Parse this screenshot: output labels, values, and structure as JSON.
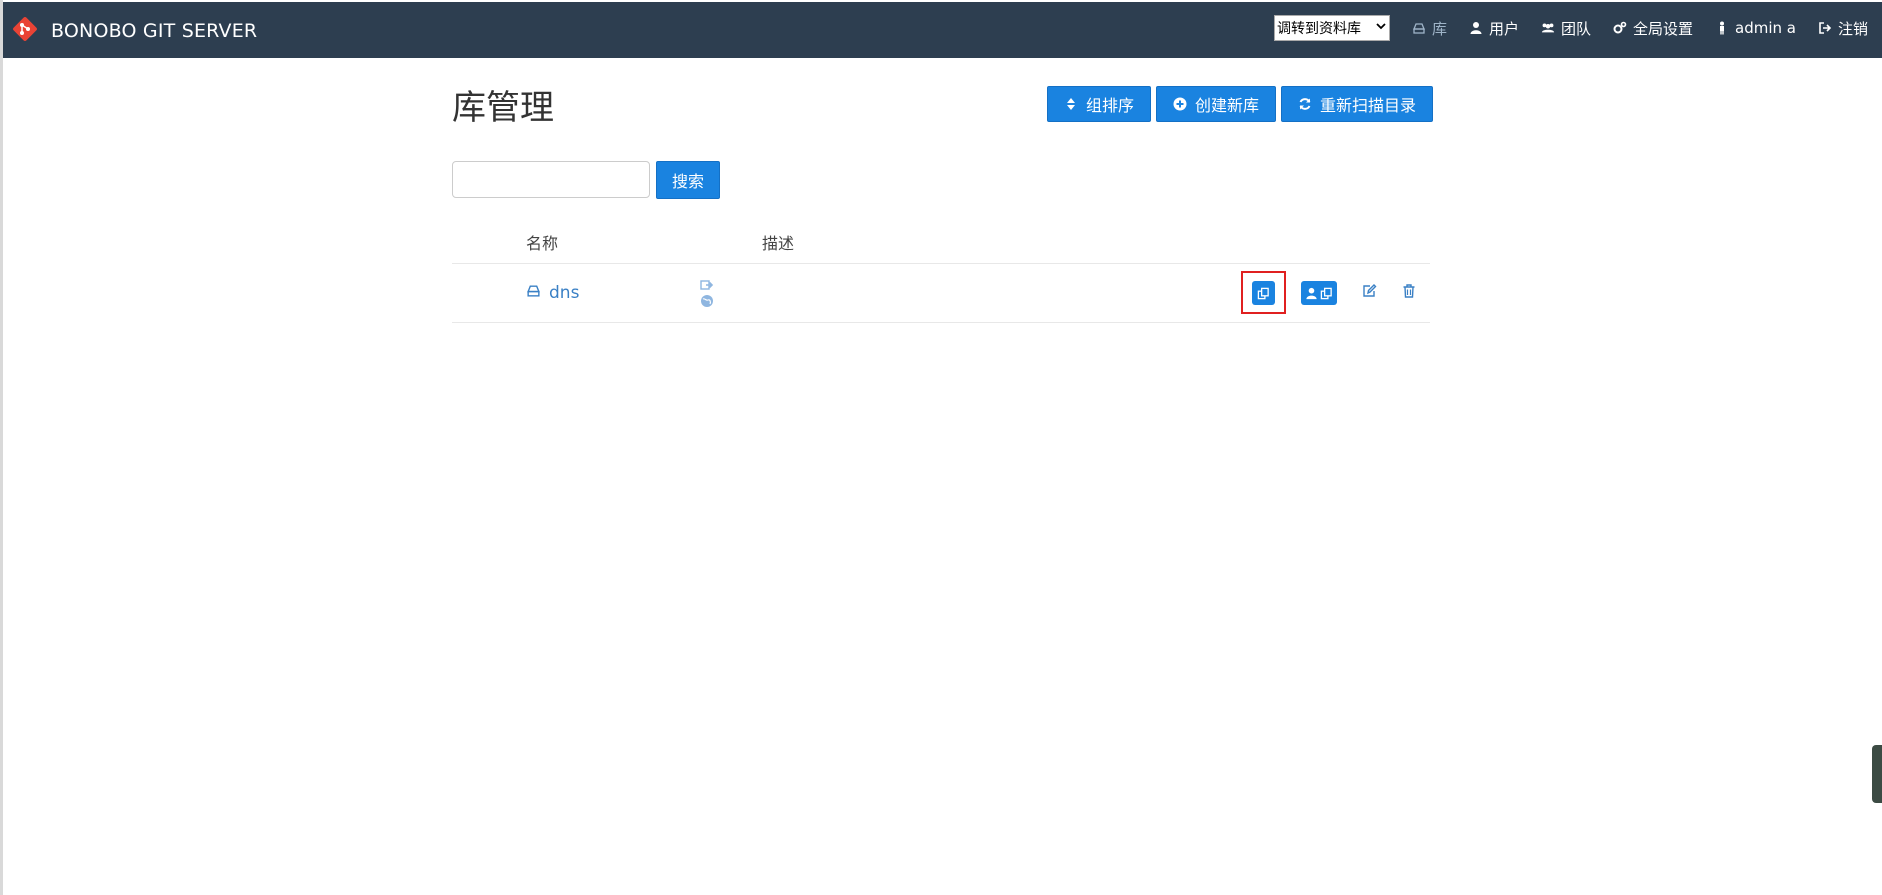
{
  "colors": {
    "navbar": "#2d3e50",
    "primary": "#1a83e0",
    "link": "#3a80c5",
    "highlight": "#e02020",
    "logo": "#e94335"
  },
  "navbar": {
    "brand": "BONOBO GIT SERVER",
    "repo_jump": {
      "selected": "调转到资料库"
    },
    "items": [
      {
        "label": "库",
        "icon": "hdd-icon",
        "active": true
      },
      {
        "label": "用户",
        "icon": "user-icon"
      },
      {
        "label": "团队",
        "icon": "team-icon"
      },
      {
        "label": "全局设置",
        "icon": "gears-icon"
      },
      {
        "label": "admin a",
        "icon": "person-icon"
      },
      {
        "label": "注销",
        "icon": "sign-out-icon"
      }
    ]
  },
  "page": {
    "title": "库管理",
    "toolbar": {
      "group_sort": "组排序",
      "create": "创建新库",
      "rescan": "重新扫描目录"
    },
    "search": {
      "button": "搜索",
      "value": "",
      "placeholder": ""
    }
  },
  "table": {
    "columns": [
      "名称",
      "描述"
    ],
    "rows": [
      {
        "name": "dns",
        "description": ""
      }
    ]
  }
}
